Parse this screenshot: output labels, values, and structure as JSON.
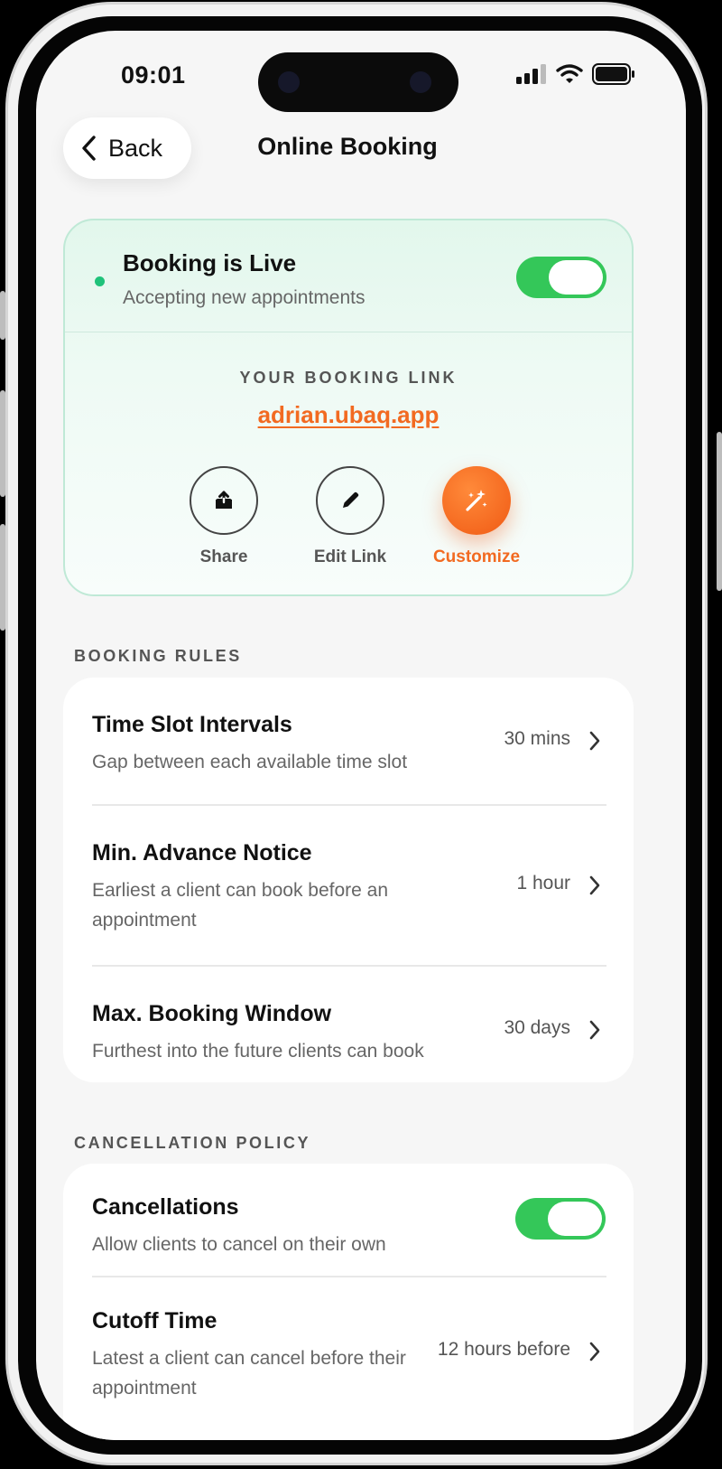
{
  "status_bar": {
    "time": "09:01"
  },
  "nav": {
    "back_label": "Back",
    "title": "Online Booking"
  },
  "live_card": {
    "title": "Booking is Live",
    "subtitle": "Accepting new appointments",
    "toggle_on": true,
    "link_label": "YOUR BOOKING LINK",
    "link_url": "adrian.ubaq.app",
    "actions": [
      {
        "label": "Share",
        "icon": "share-icon"
      },
      {
        "label": "Edit Link",
        "icon": "pencil-icon"
      },
      {
        "label": "Customize",
        "icon": "magic-wand-icon"
      }
    ]
  },
  "booking_rules": {
    "section_label": "BOOKING RULES",
    "rows": [
      {
        "title": "Time Slot Intervals",
        "description": "Gap between each available time slot",
        "value": "30 mins"
      },
      {
        "title": "Min. Advance Notice",
        "description": "Earliest a client can book before an appointment",
        "value": "1 hour"
      },
      {
        "title": "Max. Booking Window",
        "description": "Furthest into the future clients can book",
        "value": "30 days"
      }
    ]
  },
  "cancellation_policy": {
    "section_label": "CANCELLATION POLICY",
    "cancellations": {
      "title": "Cancellations",
      "description": "Allow clients to cancel on their own",
      "toggle_on": true
    },
    "cutoff": {
      "title": "Cutoff Time",
      "description": "Latest a client can cancel before their appointment",
      "value": "12 hours before"
    }
  },
  "colors": {
    "accent": "#f26a21",
    "toggle_on": "#34c759",
    "live_dot": "#1fc27a"
  }
}
